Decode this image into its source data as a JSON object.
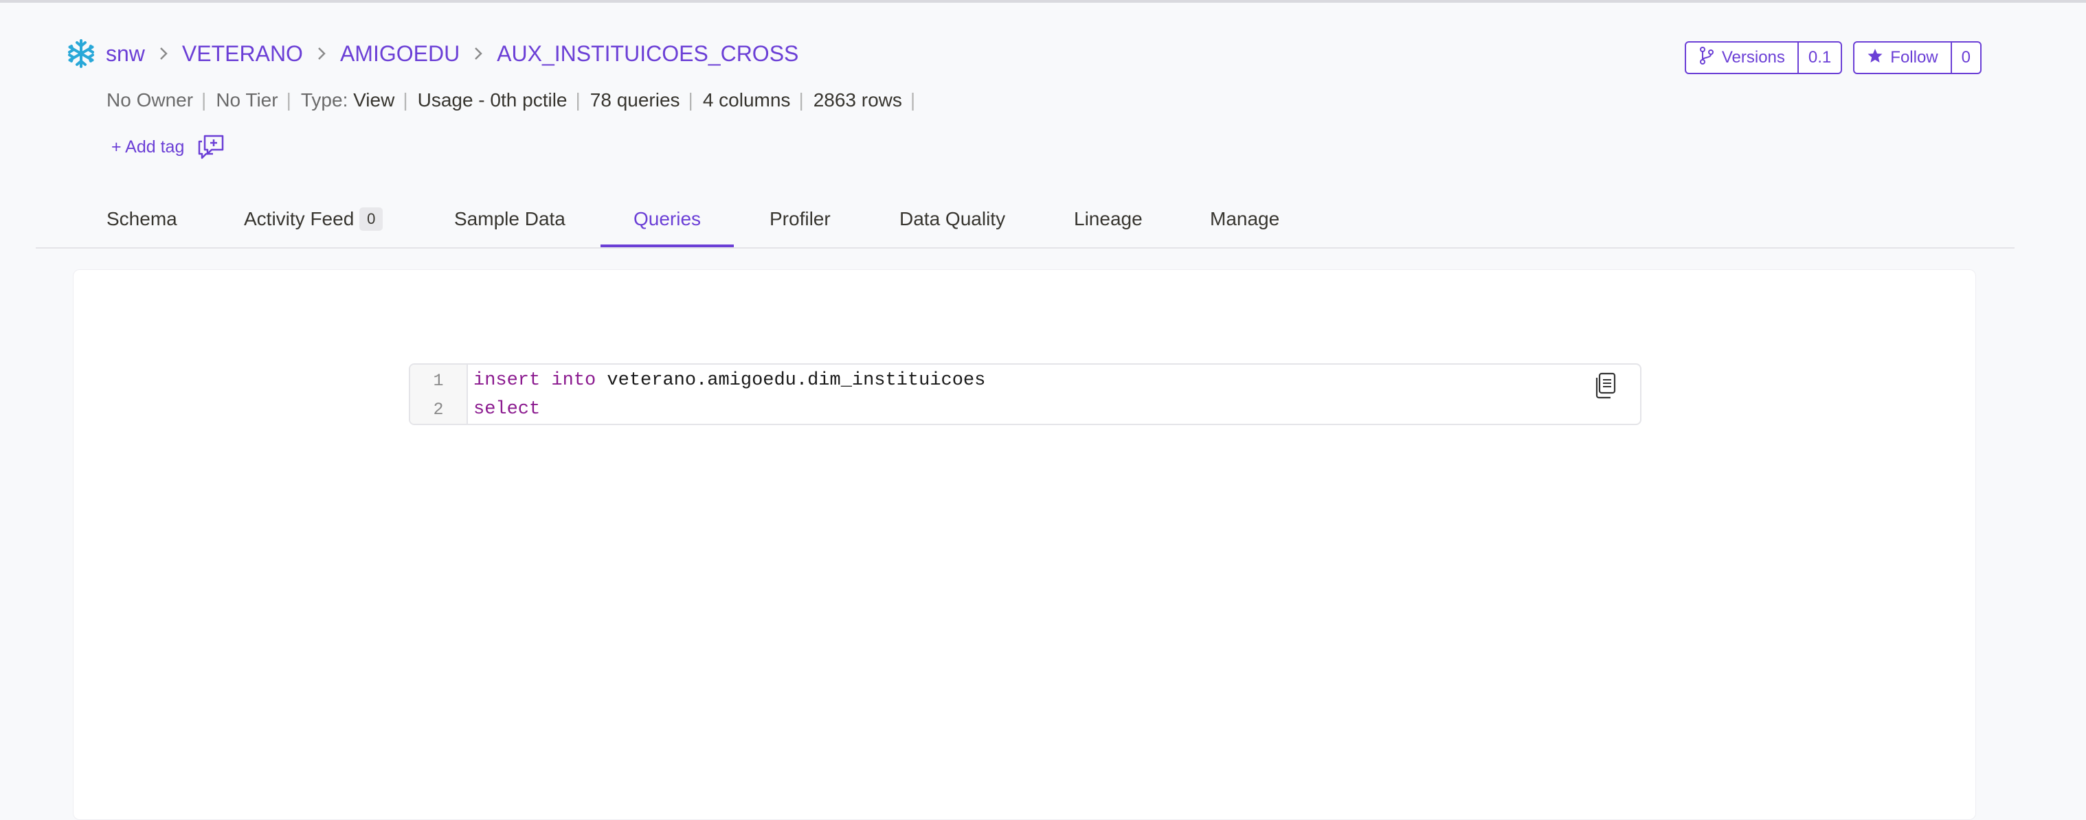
{
  "breadcrumb": {
    "logo_icon": "snowflake-icon",
    "items": [
      "snw",
      "VETERANO",
      "AMIGOEDU",
      "AUX_INSTITUICOES_CROSS"
    ],
    "separator_icon": "chevron-right-icon"
  },
  "meta": {
    "owner": "No Owner",
    "tier": "No Tier",
    "type_label": "Type:",
    "type_value": "View",
    "usage": "Usage - 0th pctile",
    "queries": "78 queries",
    "columns": "4 columns",
    "rows": "2863 rows"
  },
  "tags": {
    "add_label": "+ Add tag",
    "chat_icon": "add-conversation-icon"
  },
  "actions": {
    "versions_label": "Versions",
    "versions_value": "0.1",
    "follow_label": "Follow",
    "follow_count": "0"
  },
  "tabs": [
    {
      "label": "Schema"
    },
    {
      "label": "Activity Feed",
      "count": "0"
    },
    {
      "label": "Sample Data"
    },
    {
      "label": "Queries",
      "active": true
    },
    {
      "label": "Profiler"
    },
    {
      "label": "Data Quality"
    },
    {
      "label": "Lineage"
    },
    {
      "label": "Manage"
    }
  ],
  "query": {
    "lines": [
      {
        "number": "1",
        "keyword": "insert into",
        "rest": " veterano.amigoedu.dim_instituicoes"
      },
      {
        "number": "2",
        "keyword": "select",
        "rest": ""
      }
    ],
    "copy_icon": "copy-icon"
  },
  "colors": {
    "accent": "#6b3fd6",
    "keyword": "#8b1a8f",
    "background": "#f8f9fb"
  }
}
